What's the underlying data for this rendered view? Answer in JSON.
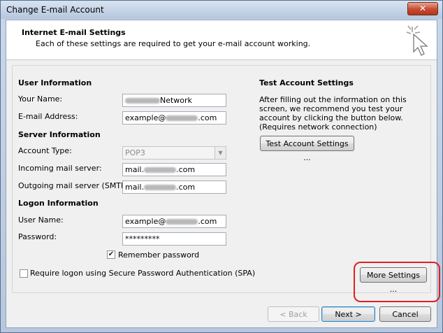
{
  "window": {
    "title": "Change E-mail Account",
    "close_label": "✕"
  },
  "header": {
    "title": "Internet E-mail Settings",
    "subtitle": "Each of these settings are required to get your e-mail account working."
  },
  "user_info": {
    "section_title": "User Information",
    "your_name_label": "Your Name:",
    "your_name_value": "Network",
    "email_label": "E-mail Address:",
    "email_prefix": "example@",
    "email_suffix": ".com"
  },
  "server_info": {
    "section_title": "Server Information",
    "account_type_label": "Account Type:",
    "account_type_value": "POP3",
    "incoming_label": "Incoming mail server:",
    "incoming_prefix": "mail.",
    "incoming_suffix": ".com",
    "outgoing_label": "Outgoing mail server (SMTP):",
    "outgoing_prefix": "mail.",
    "outgoing_suffix": ".com"
  },
  "logon_info": {
    "section_title": "Logon Information",
    "user_name_label": "User Name:",
    "user_name_prefix": "example@",
    "user_name_suffix": ".com",
    "password_label": "Password:",
    "password_value": "*********",
    "remember_label": "Remember password",
    "remember_checked": true,
    "spa_label": "Require logon using Secure Password Authentication (SPA)",
    "spa_checked": false
  },
  "test_settings": {
    "section_title": "Test Account Settings",
    "description": "After filling out the information on this screen, we recommend you test your account by clicking the button below. (Requires network connection)",
    "test_button_label": "Test Account Settings ..."
  },
  "more_settings_label": "More Settings ...",
  "footer": {
    "back_label": "< Back",
    "next_label": "Next >",
    "cancel_label": "Cancel"
  },
  "colors": {
    "highlight_ring": "#e02020",
    "close_button": "#c54b2f"
  }
}
